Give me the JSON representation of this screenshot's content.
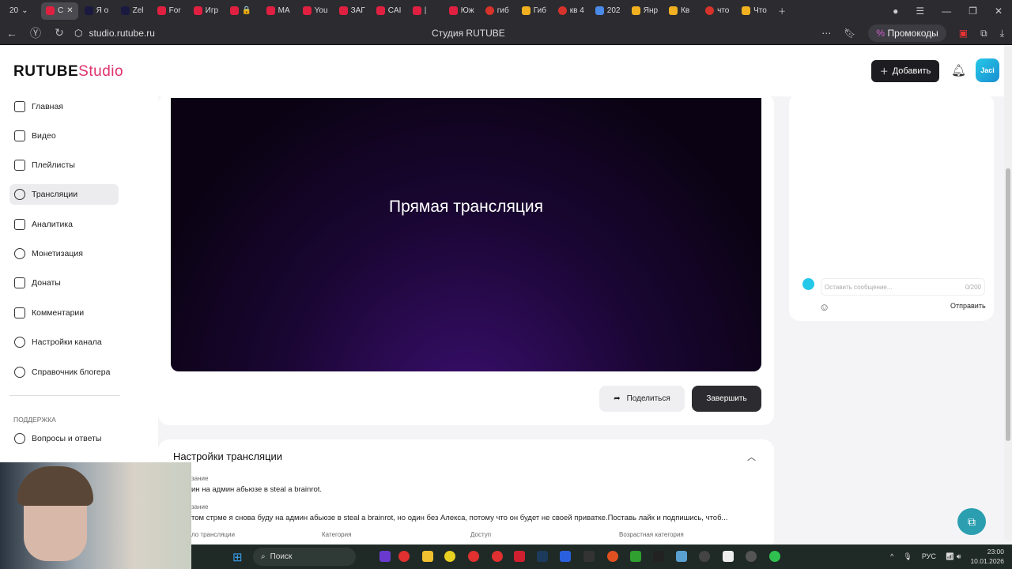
{
  "browser": {
    "tab_count": "20",
    "tabs": [
      "С",
      "Я о",
      "Zel",
      "For",
      "Игр",
      "🔒",
      "MA",
      "You",
      "ЗАГ",
      "CAI",
      "|",
      "Юж",
      "гиб",
      "Гиб",
      "кв 4",
      "202",
      "Янр",
      "Кв",
      "что",
      "Что"
    ],
    "url": "studio.rutube.ru",
    "page_title": "Студия RUTUBE",
    "promo": "Промокоды"
  },
  "header": {
    "logo_main": "RUTUBE",
    "logo_sub": "Studio",
    "add_label": "Добавить",
    "avatar_text": "Jaci"
  },
  "sidebar": {
    "items": [
      {
        "label": "Главная"
      },
      {
        "label": "Видео"
      },
      {
        "label": "Плейлисты"
      },
      {
        "label": "Трансляции"
      },
      {
        "label": "Аналитика"
      },
      {
        "label": "Монетизация"
      },
      {
        "label": "Донаты"
      },
      {
        "label": "Комментарии"
      },
      {
        "label": "Настройки канала"
      },
      {
        "label": "Справочник блогера"
      }
    ],
    "support_label": "ПОДДЕРЖКА",
    "support_items": [
      {
        "label": "Вопросы и ответы"
      }
    ]
  },
  "player": {
    "title": "Прямая трансляция"
  },
  "actions": {
    "share": "Поделиться",
    "finish": "Завершить"
  },
  "chat": {
    "placeholder": "Оставить сообщение...",
    "counter": "0/200",
    "send": "Отправить"
  },
  "settings": {
    "title": "Настройки трансляции",
    "name_label": "зание",
    "name_value": "ин на админ абьюзе в steal a brainrot.",
    "desc_label": "зание",
    "desc_value": "том стрме я снова буду на админ абьюзе в steal a brainrot, но один без Алекса, потому что он будет не своей приватке.Поставь лайк и подпишись, чтоб...",
    "fields": [
      "ло трансляции",
      "Категория",
      "Доступ",
      "Возрастная категория"
    ]
  },
  "taskbar": {
    "search": "Поиск",
    "lang": "РУС",
    "time": "23:00",
    "date": "10.01.2026"
  }
}
